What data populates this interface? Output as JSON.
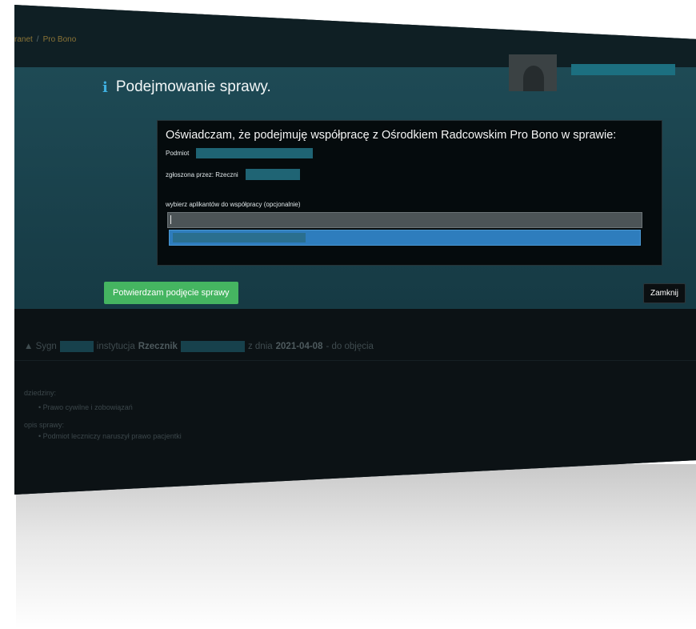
{
  "breadcrumb": {
    "parent": "ranet",
    "separator": "/",
    "current": "Pro Bono"
  },
  "modal": {
    "title": "Podejmowanie sprawy.",
    "info_icon": "i",
    "declaration": "Oświadczam, że podejmuję współpracę z Ośrodkiem Radcowskim Pro Bono w sprawie:",
    "podmiot_label": "Podmiot",
    "zgloszona_label": "zgłoszona przez: Rzeczni",
    "applicants_label": "wybierz aplikantów do współpracy (opcjonalnie)",
    "confirm_button": "Potwierdzam podjęcie sprawy",
    "close_button": "Zamknij"
  },
  "case": {
    "sygn_prefix": "▲ Sygn",
    "instytucja_label": "instytucja",
    "instytucja_value": "Rzecznik",
    "date_prefix": "z dnia",
    "date": "2021-04-08",
    "status": "- do objęcia"
  },
  "details": {
    "dziedziny_label": "dziedziny:",
    "dziedziny_items": [
      "Prawo cywilne i zobowiązań"
    ],
    "opis_label": "opis sprawy:",
    "opis_items": [
      "Podmiot leczniczy naruszył prawo pacjentki"
    ]
  },
  "colors": {
    "accent_green": "#45b561",
    "dropdown_blue": "#2e7dbd",
    "redaction_teal": "#1f6474",
    "info_blue": "#3fb0e0"
  }
}
